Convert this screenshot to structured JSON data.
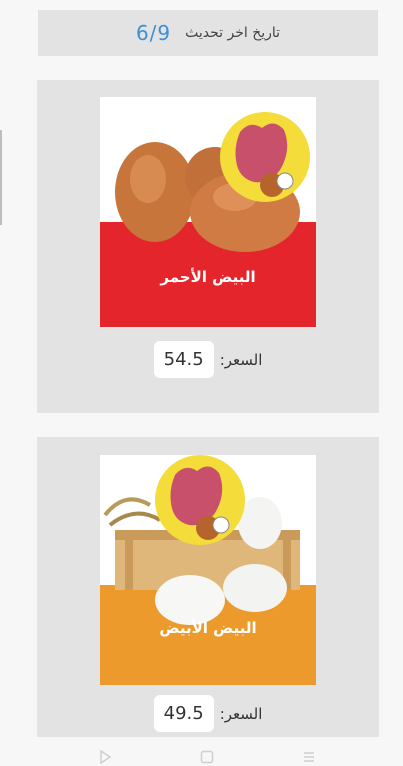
{
  "update": {
    "label": "تاريخ اخر تحديث",
    "date": "6/9"
  },
  "products": [
    {
      "name": "البيض الأحمر",
      "price_label": "السعر:",
      "price": "54.5",
      "band_color": "#e4262c"
    },
    {
      "name": "البيض الأبيض",
      "price_label": "السعر:",
      "price": "49.5",
      "band_color": "#ec9a2b"
    }
  ],
  "navbar": {
    "icons": [
      "back-triangle-icon",
      "home-square-icon",
      "menu-lines-icon"
    ]
  }
}
